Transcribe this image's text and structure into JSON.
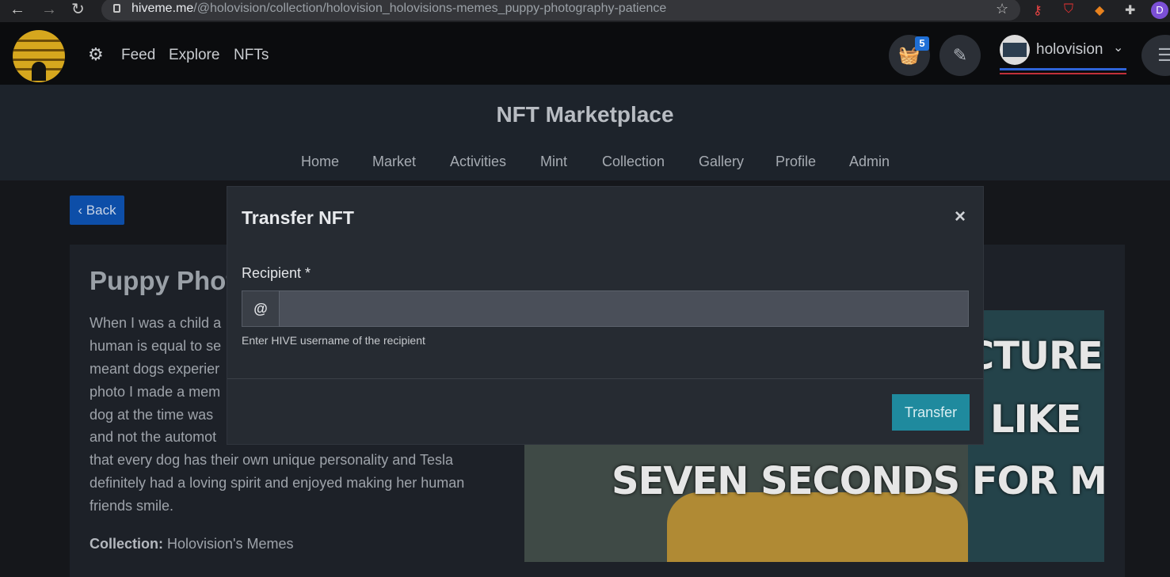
{
  "browser": {
    "url_host": "hiveme.me",
    "url_path": "/@holovision/collection/holovision_holovisions-memes_puppy-photography-patience",
    "profile_initial": "D"
  },
  "header": {
    "nav": [
      "Feed",
      "Explore",
      "NFTs"
    ],
    "cart_count": "5",
    "username": "holovision"
  },
  "marketplace": {
    "title": "NFT Marketplace",
    "tabs": [
      "Home",
      "Market",
      "Activities",
      "Mint",
      "Collection",
      "Gallery",
      "Profile",
      "Admin"
    ]
  },
  "page": {
    "back_label": "‹ Back",
    "title": "Puppy Phot",
    "description_lines": [
      "When I was a child a",
      "human is equal to se",
      "meant dogs experier",
      "photo I made a mem",
      "dog at the time was",
      "and not the automot",
      "that every dog has their own unique personality and Tesla",
      "definitely had a loving spirit and enjoyed making her human",
      "friends smile."
    ],
    "collection_label": "Collection:",
    "collection_value": "Holovision's Memes",
    "meme_lines": [
      "CTURE",
      "LIKE",
      "SEVEN SECONDS FOR ME"
    ]
  },
  "modal": {
    "title": "Transfer NFT",
    "close_glyph": "×",
    "recipient_label": "Recipient *",
    "prefix": "@",
    "recipient_value": "",
    "help_text": "Enter HIVE username of the recipient",
    "transfer_label": "Transfer"
  }
}
